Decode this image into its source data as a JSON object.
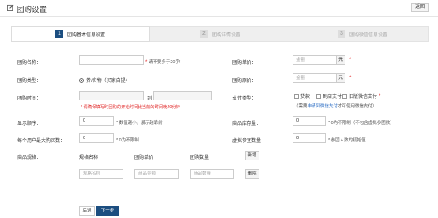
{
  "header": {
    "title": "团购设置",
    "back_label": "返回"
  },
  "steps": [
    {
      "num": "1",
      "label": "团购基本信息设置"
    },
    {
      "num": "2",
      "label": "团购详情设置"
    },
    {
      "num": "3",
      "label": "团购微信信息设置"
    }
  ],
  "form": {
    "name": {
      "label": "团购名称：",
      "hint": "请不要多于20字!"
    },
    "unit_price": {
      "label": "团购单价：",
      "placeholder": "金额",
      "unit": "元"
    },
    "type": {
      "label": "团购类型：",
      "option": "券/实物（买家自提）"
    },
    "total_price": {
      "label": "团购原价：",
      "placeholder": "金额",
      "unit": "元"
    },
    "time": {
      "label": "团购时间：",
      "to": "到",
      "warning": "* 请确保填写时团购的开始时间比当前的时间晚20分钟"
    },
    "pay_type": {
      "label": "支付类型：",
      "options": [
        "货款",
        "到店支付",
        "旧版微信支付"
      ],
      "note_prefix": "（需要",
      "note_link": "申请到微信支付",
      "note_suffix": "才可使用微信支付）"
    },
    "order": {
      "label": "显示顺序：",
      "value": "0",
      "hint": "* 数值越小，展示越靠前"
    },
    "stock": {
      "label": "商品库存量：",
      "value": "0",
      "hint": "* 0为不限制（不包含虚拟参团数）"
    },
    "limit": {
      "label": "每个用户最大购买数：",
      "value": "0",
      "hint": "* 0为不限制"
    },
    "virtual": {
      "label": "虚拟参团数量：",
      "value": "0",
      "hint": "* 参团人数的初始值"
    },
    "spec": {
      "label": "商品规格：",
      "col_name": "规格名称",
      "col_price": "团购单价",
      "col_qty": "团购数量",
      "add": "新增",
      "name_ph": "规格名称",
      "price_ph": "商品金额",
      "qty_ph": "商品数量",
      "delete": "删除"
    }
  },
  "footer": {
    "back": "后退",
    "next": "下一步"
  }
}
